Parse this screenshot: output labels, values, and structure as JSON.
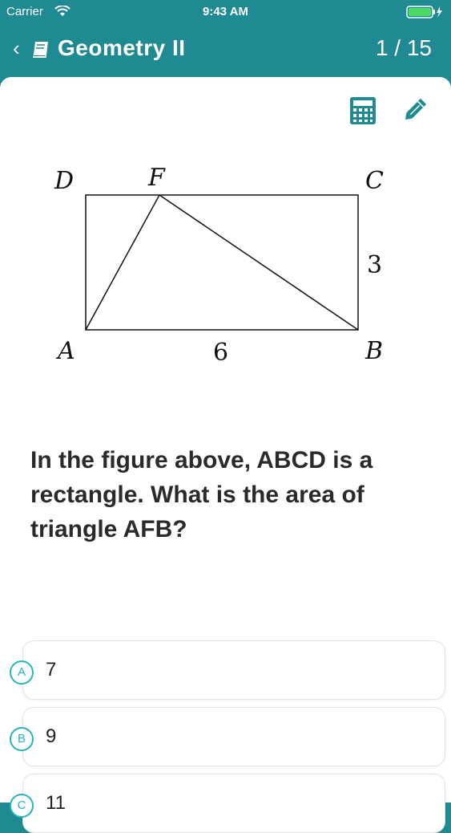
{
  "status_bar": {
    "carrier": "Carrier",
    "time": "9:43 AM"
  },
  "nav": {
    "title": "Geometry II",
    "counter": "1 / 15"
  },
  "figure": {
    "labels": {
      "D": "D",
      "F": "F",
      "C": "C",
      "A": "A",
      "B": "B",
      "side_bc": "3",
      "side_ab": "6"
    }
  },
  "question": {
    "text": "In the figure above, ABCD is a rectangle. What is the area of triangle AFB?"
  },
  "options": [
    {
      "letter": "A",
      "value": "7"
    },
    {
      "letter": "B",
      "value": "9"
    },
    {
      "letter": "C",
      "value": "11"
    }
  ],
  "colors": {
    "header": "#1f8a92",
    "accent": "#27b5bd",
    "card": "#ffffff"
  }
}
